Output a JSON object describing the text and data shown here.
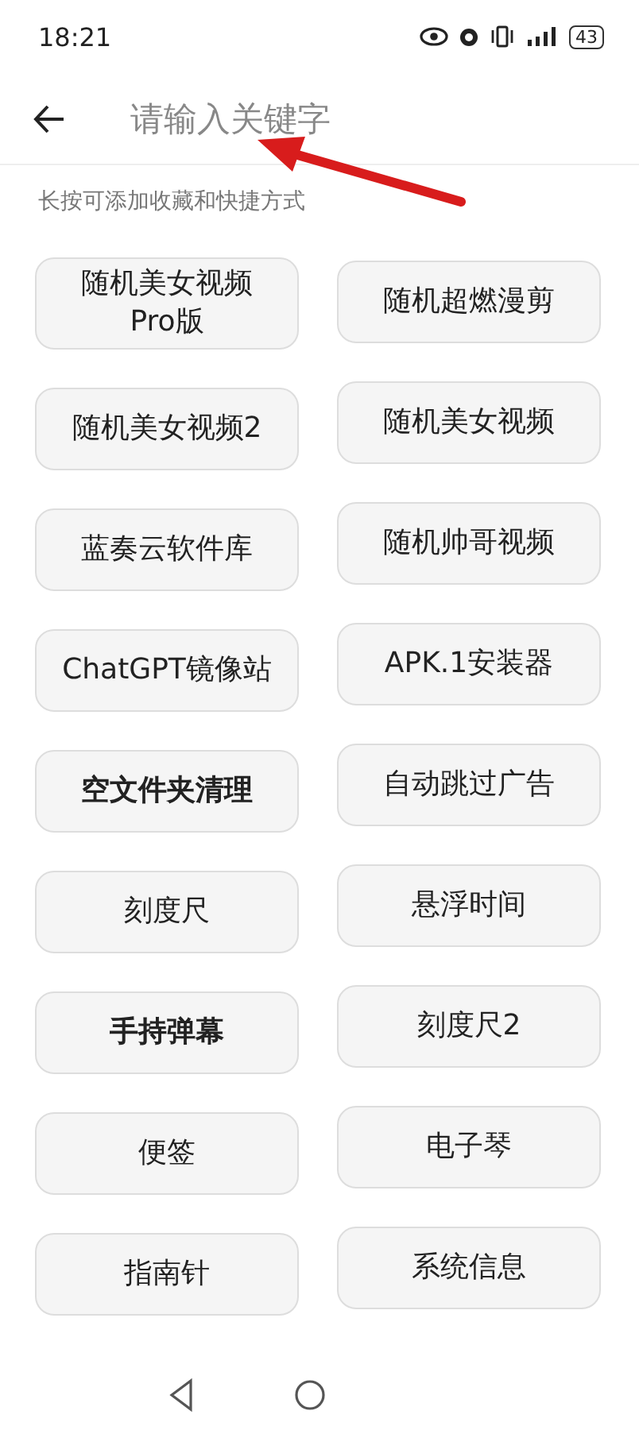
{
  "status_bar": {
    "time": "18:21",
    "battery": "43"
  },
  "search": {
    "placeholder": "请输入关键字"
  },
  "hint": "长按可添加收藏和快捷方式",
  "columns": [
    [
      {
        "label": "随机美女视频\nPro版",
        "bold": false
      },
      {
        "label": "随机美女视频2",
        "bold": false
      },
      {
        "label": "蓝奏云软件库",
        "bold": false
      },
      {
        "label": "ChatGPT镜像站",
        "bold": false
      },
      {
        "label": "空文件夹清理",
        "bold": true
      },
      {
        "label": "刻度尺",
        "bold": false
      },
      {
        "label": "手持弹幕",
        "bold": true
      },
      {
        "label": "便签",
        "bold": false
      },
      {
        "label": "指南针",
        "bold": false
      }
    ],
    [
      {
        "label": "随机超燃漫剪",
        "bold": false
      },
      {
        "label": "随机美女视频",
        "bold": false
      },
      {
        "label": "随机帅哥视频",
        "bold": false
      },
      {
        "label": "APK.1安装器",
        "bold": false
      },
      {
        "label": "自动跳过广告",
        "bold": false
      },
      {
        "label": "悬浮时间",
        "bold": false
      },
      {
        "label": "刻度尺2",
        "bold": false
      },
      {
        "label": "电子琴",
        "bold": false
      },
      {
        "label": "系统信息",
        "bold": false
      }
    ]
  ]
}
